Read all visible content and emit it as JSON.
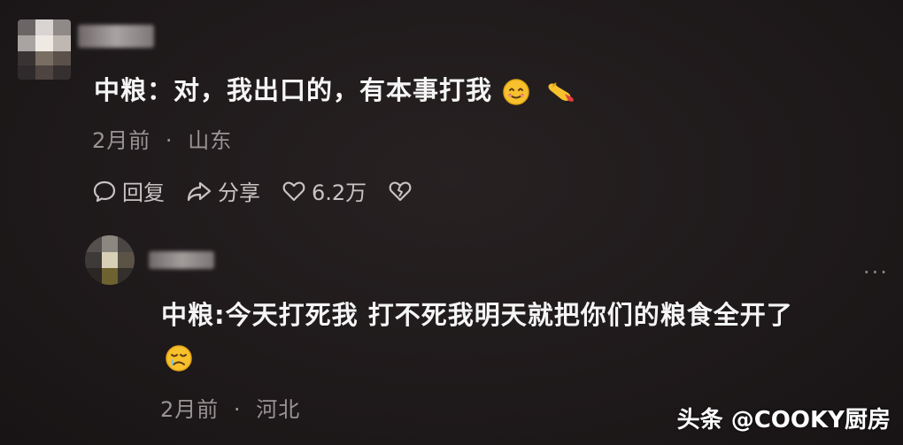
{
  "comment1": {
    "text": "中粮：对，我出口的，有本事打我",
    "emoji": [
      "smile-emoji",
      "hand-emoji"
    ],
    "time": "2月前",
    "separator": "·",
    "location": "山东",
    "actions": {
      "reply_label": "回复",
      "share_label": "分享",
      "like_count": "6.2万"
    }
  },
  "reply1": {
    "text": "中粮:今天打死我 打不死我明天就把你们的粮食全开了",
    "emoji": [
      "cry-emoji"
    ],
    "time": "2月前",
    "separator": "·",
    "location": "河北",
    "more": "···"
  },
  "watermark": "头条 @COOKY厨房",
  "colors": {
    "background": "#1f1a1b",
    "text": "#f5f5f5",
    "meta": "#9a9495",
    "emoji_yellow": "#f7c02d"
  }
}
